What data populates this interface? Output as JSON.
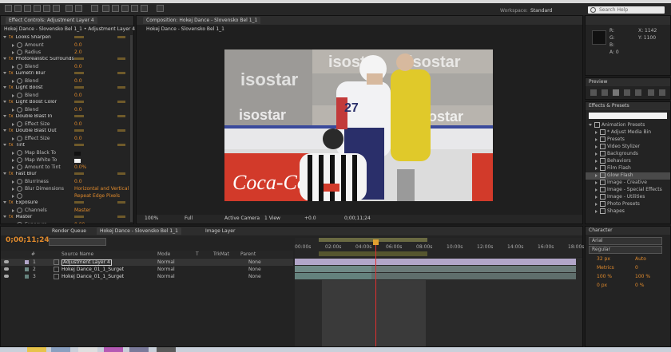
{
  "menubar": {
    "items": [
      "Ae",
      "File",
      "Edit",
      "Composition",
      "Layer",
      "Effect",
      "Animation",
      "View",
      "Window",
      "Help"
    ]
  },
  "toolbar": {
    "workspace_label": "Workspace:",
    "workspace_value": "Standard",
    "search_placeholder": "Search Help"
  },
  "effect_controls": {
    "tab": "Effect Controls: Adjustment Layer 4",
    "breadcrumb": "Hokej Dance - Slovensko Bel 1_1 • Adjustment Layer 4",
    "effects": [
      {
        "name": "Looks Sharpen",
        "props": [
          {
            "n": "Amount",
            "v": "0.0"
          },
          {
            "n": "Radius",
            "v": "2.0"
          }
        ]
      },
      {
        "name": "Photorealistic Surrounds",
        "props": [
          {
            "n": "Blend",
            "v": "0.0"
          }
        ]
      },
      {
        "name": "Lumetri Blur",
        "props": [
          {
            "n": "Blend",
            "v": "0.0"
          }
        ]
      },
      {
        "name": "Light Boost",
        "props": [
          {
            "n": "Blend",
            "v": "0.0"
          }
        ]
      },
      {
        "name": "Light Boost Color",
        "props": [
          {
            "n": "Blend",
            "v": "0.0"
          }
        ]
      },
      {
        "name": "Double Blast In",
        "props": [
          {
            "n": "Effect Size",
            "v": "0.0"
          }
        ]
      },
      {
        "name": "Double Blast Out",
        "props": [
          {
            "n": "Effect Size",
            "v": "0.0"
          }
        ]
      },
      {
        "name": "Tint",
        "props": [
          {
            "n": "Map Black To",
            "v": ""
          },
          {
            "n": "Map White To",
            "v": ""
          },
          {
            "n": "Amount to Tint",
            "v": "0.0%"
          }
        ]
      },
      {
        "name": "Fast Blur",
        "props": [
          {
            "n": "Blurriness",
            "v": "0.0"
          },
          {
            "n": "Blur Dimensions",
            "v": "Horizontal and Vertical"
          },
          {
            "n": "",
            "v": "Repeat Edge Pixels"
          }
        ]
      },
      {
        "name": "Exposure",
        "props": [
          {
            "n": "Channels",
            "v": "Master"
          }
        ]
      },
      {
        "name": "Master",
        "props": [
          {
            "n": "Exposure",
            "v": "0.00"
          }
        ]
      }
    ]
  },
  "composition": {
    "tab": "Composition: Hokej Dance - Slovensko Bel 1_1",
    "subtab": "Hokej Dance - Slovensko Bel 1_1",
    "footer": [
      "100%",
      "Full",
      "Active Camera",
      "1 View",
      "+0.0"
    ],
    "timecode": "0;00;11;24"
  },
  "video": {
    "brand_text": "isostar",
    "player_number": "27",
    "ad_text": "Coca-Cola"
  },
  "info_panel": {
    "readout": [
      "R:",
      "G:",
      "B:",
      "A: 0"
    ],
    "coords": [
      "X: 1142",
      "Y: 1100"
    ]
  },
  "preview_panel": {
    "title": "Preview"
  },
  "effects_presets": {
    "title": "Effects & Presets",
    "search": "",
    "items": [
      "Animation Presets",
      "* Adjust Media Bin",
      "Presets",
      "Video Stylizer",
      "Backgrounds",
      "Behaviors",
      "Film Flash",
      "Glow Flash",
      "Image - Creative",
      "Image - Special Effects",
      "Image - Utilities",
      "Photo Presets",
      "Shapes"
    ]
  },
  "timeline": {
    "timecode": "0;00;11;24",
    "tabs": [
      "Render Queue",
      "Hokej Dance - Slovensko Bel 1_1",
      "Image Layer"
    ],
    "columns": [
      "#",
      "Source Name",
      "Mode",
      "T",
      "TrkMat",
      "Parent"
    ],
    "layers": [
      {
        "num": "1",
        "name": "Adjustment Layer 4",
        "mode": "Normal",
        "parent": "None"
      },
      {
        "num": "2",
        "name": "Hokej Dance_01_1_Surget",
        "mode": "Normal",
        "parent": "None"
      },
      {
        "num": "3",
        "name": "Hokej Dance_01_1_Surget",
        "mode": "Normal",
        "parent": "None"
      }
    ],
    "ruler": [
      "00:00s",
      "02:00s",
      "04:00s",
      "06:00s",
      "08:00s",
      "10:00s",
      "12:00s",
      "14:00s",
      "16:00s",
      "18:00s"
    ]
  },
  "character_panel": {
    "title": "Character",
    "font": "Arial",
    "style": "Regular",
    "values": [
      "32 px",
      "Auto",
      "Metrics",
      "0",
      "100 %",
      "100 %",
      "0 px",
      "0 %"
    ]
  }
}
